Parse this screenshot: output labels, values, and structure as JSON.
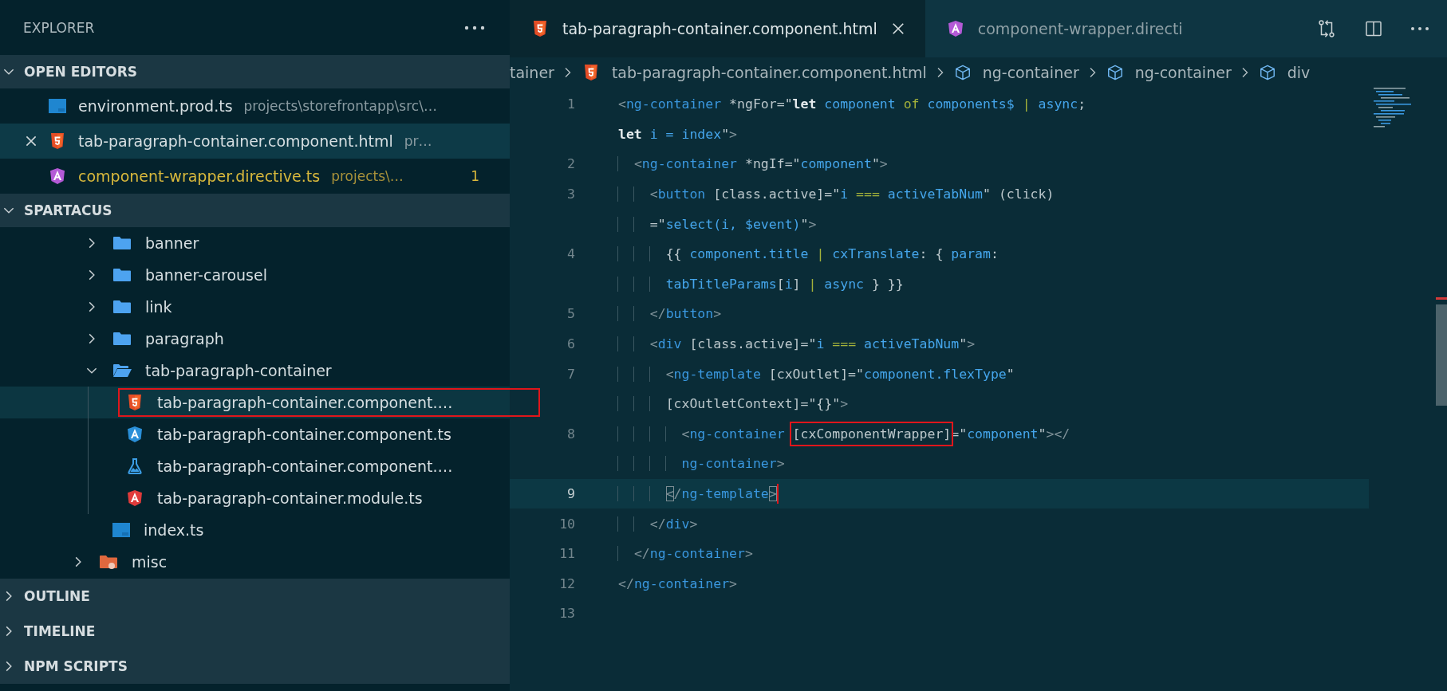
{
  "sidebar": {
    "title": "EXPLORER",
    "sections": [
      {
        "kind": "editors",
        "title": "OPEN EDITORS",
        "expanded": true,
        "items": [
          {
            "kind": "ts",
            "name": "environment.prod.ts",
            "description": "projects\\storefrontapp\\src\\…",
            "selected": false,
            "warning": false
          },
          {
            "kind": "html",
            "name": "tab-paragraph-container.component.html",
            "description": "pr…",
            "selected": true,
            "warning": false
          },
          {
            "kind": "angular-directive",
            "name": "component-wrapper.directive.ts",
            "description": "projects\\…",
            "selected": false,
            "warning": true,
            "badge": "1"
          }
        ]
      },
      {
        "kind": "tree",
        "title": "SPARTACUS",
        "expanded": true,
        "items": [
          {
            "kind": "scrolled-parent",
            "children": [
              {
                "kind": "folder",
                "label": "banner",
                "expanded": false,
                "selected": false
              },
              {
                "kind": "folder",
                "label": "banner-carousel",
                "expanded": false,
                "selected": false
              },
              {
                "kind": "folder",
                "label": "link",
                "expanded": false,
                "selected": false
              },
              {
                "kind": "folder",
                "label": "paragraph",
                "expanded": false,
                "selected": false
              },
              {
                "kind": "folder",
                "label": "tab-paragraph-container",
                "expanded": true,
                "selected": false,
                "children": [
                  {
                    "kind": "html",
                    "label": "tab-paragraph-container.component.…",
                    "selected": true,
                    "highlighted": true
                  },
                  {
                    "kind": "angular-component",
                    "label": "tab-paragraph-container.component.ts",
                    "selected": false,
                    "highlighted": false
                  },
                  {
                    "kind": "test",
                    "label": "tab-paragraph-container.component.…",
                    "selected": false,
                    "highlighted": false
                  },
                  {
                    "kind": "angular-module",
                    "label": "tab-paragraph-container.module.ts",
                    "selected": false,
                    "highlighted": false
                  }
                ]
              },
              {
                "kind": "ts",
                "label": "index.ts",
                "selected": false,
                "highlighted": false
              }
            ]
          },
          {
            "kind": "special-folder",
            "label": "misc",
            "expanded": false,
            "selected": false
          }
        ]
      },
      {
        "kind": "panel",
        "title": "OUTLINE",
        "expanded": false
      },
      {
        "kind": "panel",
        "title": "TIMELINE",
        "expanded": false
      },
      {
        "kind": "panel",
        "title": "NPM SCRIPTS",
        "expanded": false
      }
    ]
  },
  "editor": {
    "tabs": [
      {
        "kind": "html",
        "label": "tab-paragraph-container.component.html",
        "selected": true
      },
      {
        "kind": "angular-directive",
        "label": "component-wrapper.directi",
        "selected": false
      }
    ],
    "breadcrumb": [
      {
        "kind": "text",
        "label": "tainer"
      },
      {
        "kind": "html",
        "label": "tab-paragraph-container.component.html"
      },
      {
        "kind": "symbol",
        "label": "ng-container"
      },
      {
        "kind": "symbol",
        "label": "ng-container"
      },
      {
        "kind": "symbol",
        "label": "div"
      }
    ],
    "code": {
      "lines": [
        {
          "number": "1",
          "current": false,
          "rows": [
            {
              "tokens": [
                {
                  "kind": "punct",
                  "text": "<"
                },
                {
                  "kind": "tag",
                  "text": "ng-container"
                },
                {
                  "kind": "attr",
                  "text": " *ngFor=\""
                },
                {
                  "kind": "keyword",
                  "text": "let"
                },
                {
                  "kind": "expr",
                  "text": " component "
                },
                {
                  "kind": "operator",
                  "text": "of"
                },
                {
                  "kind": "expr",
                  "text": " components$ "
                },
                {
                  "kind": "operator",
                  "text": "|"
                },
                {
                  "kind": "expr",
                  "text": " async"
                },
                {
                  "kind": "attr",
                  "text": ";"
                }
              ]
            },
            {
              "tokens": [
                {
                  "kind": "keyword",
                  "text": "let"
                },
                {
                  "kind": "expr",
                  "text": " i = index"
                },
                {
                  "kind": "attr",
                  "text": "\""
                },
                {
                  "kind": "punct",
                  "text": ">"
                }
              ]
            }
          ]
        },
        {
          "number": "2",
          "current": false,
          "rows": [
            {
              "indent": "  ",
              "tokens": [
                {
                  "kind": "punct",
                  "text": "<"
                },
                {
                  "kind": "tag",
                  "text": "ng-container"
                },
                {
                  "kind": "attr",
                  "text": " *ngIf=\""
                },
                {
                  "kind": "expr",
                  "text": "component"
                },
                {
                  "kind": "attr",
                  "text": "\""
                },
                {
                  "kind": "punct",
                  "text": ">"
                }
              ]
            }
          ]
        },
        {
          "number": "3",
          "current": false,
          "rows": [
            {
              "indent": "    ",
              "tokens": [
                {
                  "kind": "punct",
                  "text": "<"
                },
                {
                  "kind": "tag",
                  "text": "button"
                },
                {
                  "kind": "attr",
                  "text": " [class.active]=\""
                },
                {
                  "kind": "expr",
                  "text": "i "
                },
                {
                  "kind": "operator",
                  "text": "==="
                },
                {
                  "kind": "expr",
                  "text": " activeTabNum"
                },
                {
                  "kind": "attr",
                  "text": "\" (click)"
                }
              ]
            },
            {
              "indent": "    ",
              "tokens": [
                {
                  "kind": "attr",
                  "text": "=\""
                },
                {
                  "kind": "expr",
                  "text": "select(i, $event)"
                },
                {
                  "kind": "attr",
                  "text": "\""
                },
                {
                  "kind": "punct",
                  "text": ">"
                }
              ]
            }
          ]
        },
        {
          "number": "4",
          "current": false,
          "rows": [
            {
              "indent": "      ",
              "tokens": [
                {
                  "kind": "attr",
                  "text": "{{ "
                },
                {
                  "kind": "expr",
                  "text": "component.title "
                },
                {
                  "kind": "operator",
                  "text": "|"
                },
                {
                  "kind": "expr",
                  "text": " cxTranslate"
                },
                {
                  "kind": "attr",
                  "text": ": { "
                },
                {
                  "kind": "expr",
                  "text": "param"
                },
                {
                  "kind": "attr",
                  "text": ":"
                }
              ]
            },
            {
              "indent": "      ",
              "tokens": [
                {
                  "kind": "expr",
                  "text": "tabTitleParams"
                },
                {
                  "kind": "attr",
                  "text": "["
                },
                {
                  "kind": "expr",
                  "text": "i"
                },
                {
                  "kind": "attr",
                  "text": "] "
                },
                {
                  "kind": "operator",
                  "text": "|"
                },
                {
                  "kind": "expr",
                  "text": " async"
                },
                {
                  "kind": "attr",
                  "text": " } }}"
                }
              ]
            }
          ]
        },
        {
          "number": "5",
          "current": false,
          "rows": [
            {
              "indent": "    ",
              "tokens": [
                {
                  "kind": "punct",
                  "text": "</"
                },
                {
                  "kind": "tag",
                  "text": "button"
                },
                {
                  "kind": "punct",
                  "text": ">"
                }
              ]
            }
          ]
        },
        {
          "number": "6",
          "current": false,
          "rows": [
            {
              "indent": "    ",
              "tokens": [
                {
                  "kind": "punct",
                  "text": "<"
                },
                {
                  "kind": "tag",
                  "text": "div"
                },
                {
                  "kind": "attr",
                  "text": " [class.active]=\""
                },
                {
                  "kind": "expr",
                  "text": "i "
                },
                {
                  "kind": "operator",
                  "text": "==="
                },
                {
                  "kind": "expr",
                  "text": " activeTabNum"
                },
                {
                  "kind": "attr",
                  "text": "\""
                },
                {
                  "kind": "punct",
                  "text": ">"
                }
              ]
            }
          ]
        },
        {
          "number": "7",
          "current": false,
          "rows": [
            {
              "indent": "      ",
              "tokens": [
                {
                  "kind": "punct",
                  "text": "<"
                },
                {
                  "kind": "tag",
                  "text": "ng-template"
                },
                {
                  "kind": "attr",
                  "text": " [cxOutlet]=\""
                },
                {
                  "kind": "expr",
                  "text": "component.flexType"
                },
                {
                  "kind": "attr",
                  "text": "\""
                }
              ]
            },
            {
              "indent": "      ",
              "tokens": [
                {
                  "kind": "attr",
                  "text": "[cxOutletContext]=\"{}\""
                },
                {
                  "kind": "punct",
                  "text": ">"
                }
              ]
            }
          ]
        },
        {
          "number": "8",
          "current": false,
          "rows": [
            {
              "indent": "        ",
              "tokens": [
                {
                  "kind": "punct",
                  "text": "<"
                },
                {
                  "kind": "tag",
                  "text": "ng-container "
                },
                {
                  "kind": "attr",
                  "text": "[cxComponentWrapper]",
                  "highlighted": true
                },
                {
                  "kind": "attr",
                  "text": "=\""
                },
                {
                  "kind": "expr",
                  "text": "component"
                },
                {
                  "kind": "attr",
                  "text": "\""
                },
                {
                  "kind": "punct",
                  "text": "></"
                }
              ]
            },
            {
              "indent": "        ",
              "tokens": [
                {
                  "kind": "tag",
                  "text": "ng-container"
                },
                {
                  "kind": "punct",
                  "text": ">"
                }
              ]
            }
          ]
        },
        {
          "number": "9",
          "current": true,
          "rows": [
            {
              "indent": "      ",
              "tokens": [
                {
                  "kind": "bracket",
                  "text": "<"
                },
                {
                  "kind": "punct",
                  "text": "/"
                },
                {
                  "kind": "tag",
                  "text": "ng-template"
                },
                {
                  "kind": "bracket",
                  "text": ">"
                }
              ]
            }
          ]
        },
        {
          "number": "10",
          "current": false,
          "rows": [
            {
              "indent": "    ",
              "tokens": [
                {
                  "kind": "punct",
                  "text": "</"
                },
                {
                  "kind": "tag",
                  "text": "div"
                },
                {
                  "kind": "punct",
                  "text": ">"
                }
              ]
            }
          ]
        },
        {
          "number": "11",
          "current": false,
          "rows": [
            {
              "indent": "  ",
              "tokens": [
                {
                  "kind": "punct",
                  "text": "</"
                },
                {
                  "kind": "tag",
                  "text": "ng-container"
                },
                {
                  "kind": "punct",
                  "text": ">"
                }
              ]
            }
          ]
        },
        {
          "number": "12",
          "current": false,
          "rows": [
            {
              "tokens": [
                {
                  "kind": "punct",
                  "text": "</"
                },
                {
                  "kind": "tag",
                  "text": "ng-container"
                },
                {
                  "kind": "punct",
                  "text": ">"
                }
              ]
            }
          ]
        },
        {
          "number": "13",
          "current": false
        }
      ]
    }
  }
}
